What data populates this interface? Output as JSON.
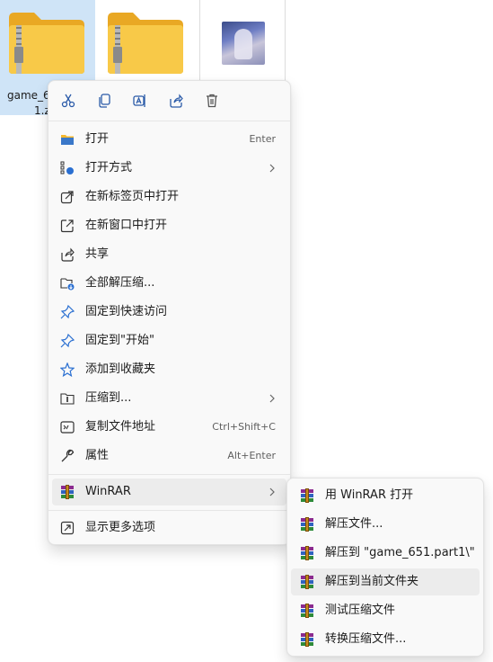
{
  "files": {
    "file1_name_line1": "game_6",
    "file1_name_line2": "1.z"
  },
  "toolbar": {
    "cut_icon": "scissors-icon",
    "copy_icon": "copy-icon",
    "rename_icon": "rename-icon",
    "share_icon": "share-icon",
    "delete_icon": "trash-icon"
  },
  "menu": {
    "items": [
      {
        "label": "打开",
        "shortcut": "Enter",
        "icon": "folder-open-icon"
      },
      {
        "label": "打开方式",
        "icon": "open-with-icon",
        "has_submenu": true
      },
      {
        "label": "在新标签页中打开",
        "icon": "new-tab-icon"
      },
      {
        "label": "在新窗口中打开",
        "icon": "new-window-icon"
      },
      {
        "label": "共享",
        "icon": "share-icon"
      },
      {
        "label": "全部解压缩...",
        "icon": "extract-all-icon"
      },
      {
        "label": "固定到快速访问",
        "icon": "pin-icon"
      },
      {
        "label": "固定到\"开始\"",
        "icon": "pin-start-icon"
      },
      {
        "label": "添加到收藏夹",
        "icon": "star-icon"
      },
      {
        "label": "压缩到...",
        "icon": "compress-icon",
        "has_submenu": true
      },
      {
        "label": "复制文件地址",
        "shortcut": "Ctrl+Shift+C",
        "icon": "copy-path-icon"
      },
      {
        "label": "属性",
        "shortcut": "Alt+Enter",
        "icon": "wrench-icon"
      }
    ],
    "winrar": {
      "label": "WinRAR",
      "icon": "winrar-icon",
      "has_submenu": true
    },
    "more": {
      "label": "显示更多选项",
      "icon": "more-options-icon"
    }
  },
  "submenu": {
    "items": [
      {
        "label": "用 WinRAR 打开"
      },
      {
        "label": "解压文件..."
      },
      {
        "label": "解压到 \"game_651.part1\\\""
      },
      {
        "label": "解压到当前文件夹"
      },
      {
        "label": "测试压缩文件"
      },
      {
        "label": "转换压缩文件..."
      }
    ],
    "hovered_index": 3
  },
  "colors": {
    "selection": "#cfe4f7",
    "menu_bg": "#f9f9f9",
    "hover": "#ececec",
    "folder": "#f8c948"
  }
}
